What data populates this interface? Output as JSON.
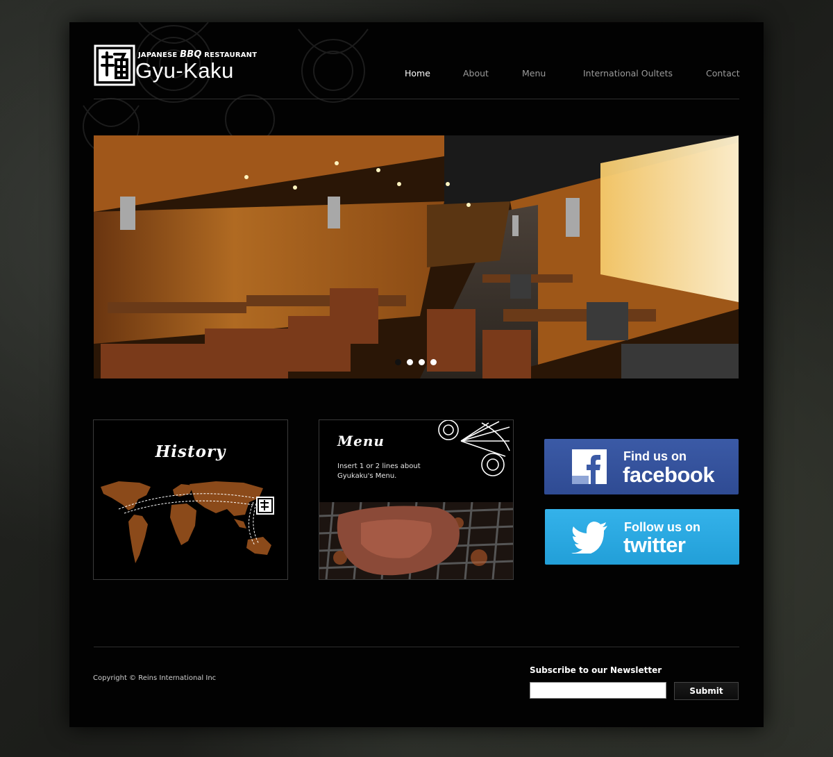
{
  "brand": {
    "subtitle_prefix": "JAPANESE ",
    "subtitle_bbq": "BBQ",
    "subtitle_suffix": " RESTAURANT",
    "name": "Gyu-Kaku"
  },
  "nav": {
    "items": [
      {
        "label": "Home",
        "active": true
      },
      {
        "label": "About",
        "active": false
      },
      {
        "label": "Menu",
        "active": false
      },
      {
        "label": "International Oultets",
        "active": false
      },
      {
        "label": "Contact",
        "active": false
      }
    ]
  },
  "slider": {
    "slide_count": 4,
    "active_index": 0
  },
  "panels": {
    "history": {
      "title": "History"
    },
    "menu": {
      "title": "Menu",
      "description": "Insert 1 or 2 lines about Gyukaku's Menu."
    }
  },
  "social": {
    "facebook": {
      "line1": "Find us on",
      "line2": "facebook",
      "icon": "facebook-f-icon",
      "color": "#3b5aa6"
    },
    "twitter": {
      "line1": "Follow us on",
      "line2": "twitter",
      "icon": "twitter-bird-icon",
      "color": "#2aa9e0"
    }
  },
  "footer": {
    "copyright": "Copyright © Reins International Inc",
    "newsletter_label": "Subscribe to our Newsletter",
    "newsletter_value": "",
    "submit_label": "Submit"
  },
  "colors": {
    "page_bg": "#020202",
    "map_fill": "#8b4a1a",
    "nav_inactive": "#9b9b9b"
  }
}
